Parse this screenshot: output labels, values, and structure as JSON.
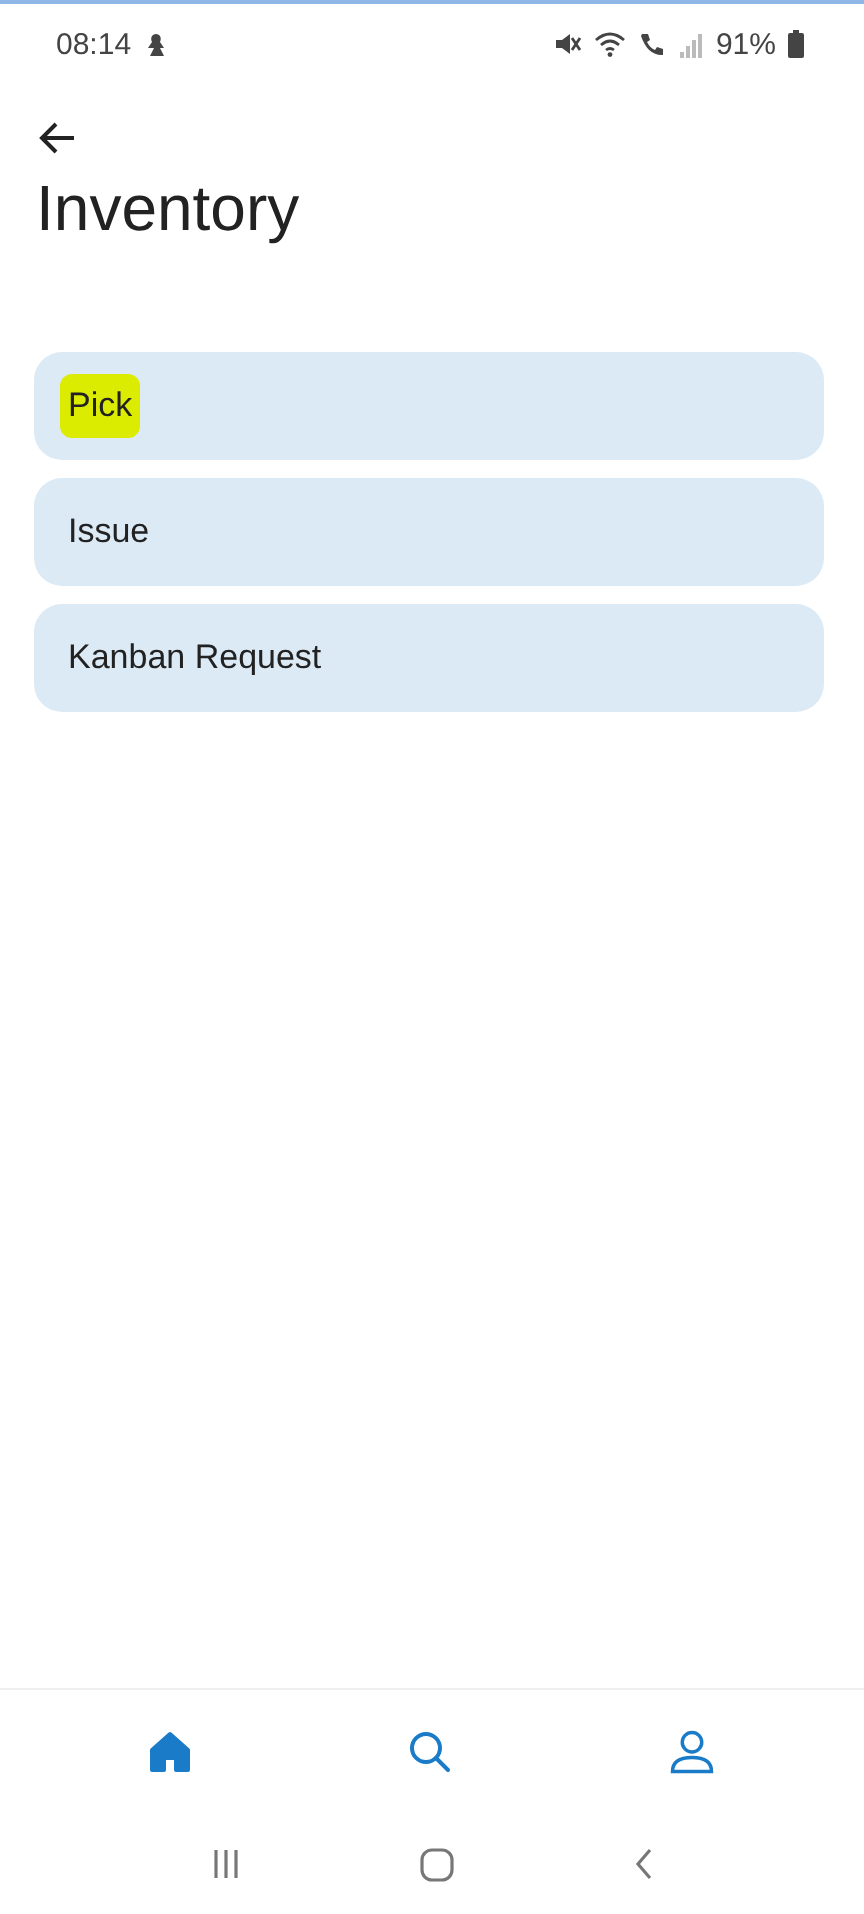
{
  "status_bar": {
    "time": "08:14",
    "battery": "91%"
  },
  "header": {
    "title": "Inventory"
  },
  "menu": [
    {
      "label": "Pick",
      "highlighted": true
    },
    {
      "label": "Issue",
      "highlighted": false
    },
    {
      "label": "Kanban Request",
      "highlighted": false
    }
  ],
  "bottom_nav": [
    {
      "kind": "home",
      "selected": true
    },
    {
      "kind": "search",
      "selected": false
    },
    {
      "kind": "profile",
      "selected": false
    }
  ]
}
